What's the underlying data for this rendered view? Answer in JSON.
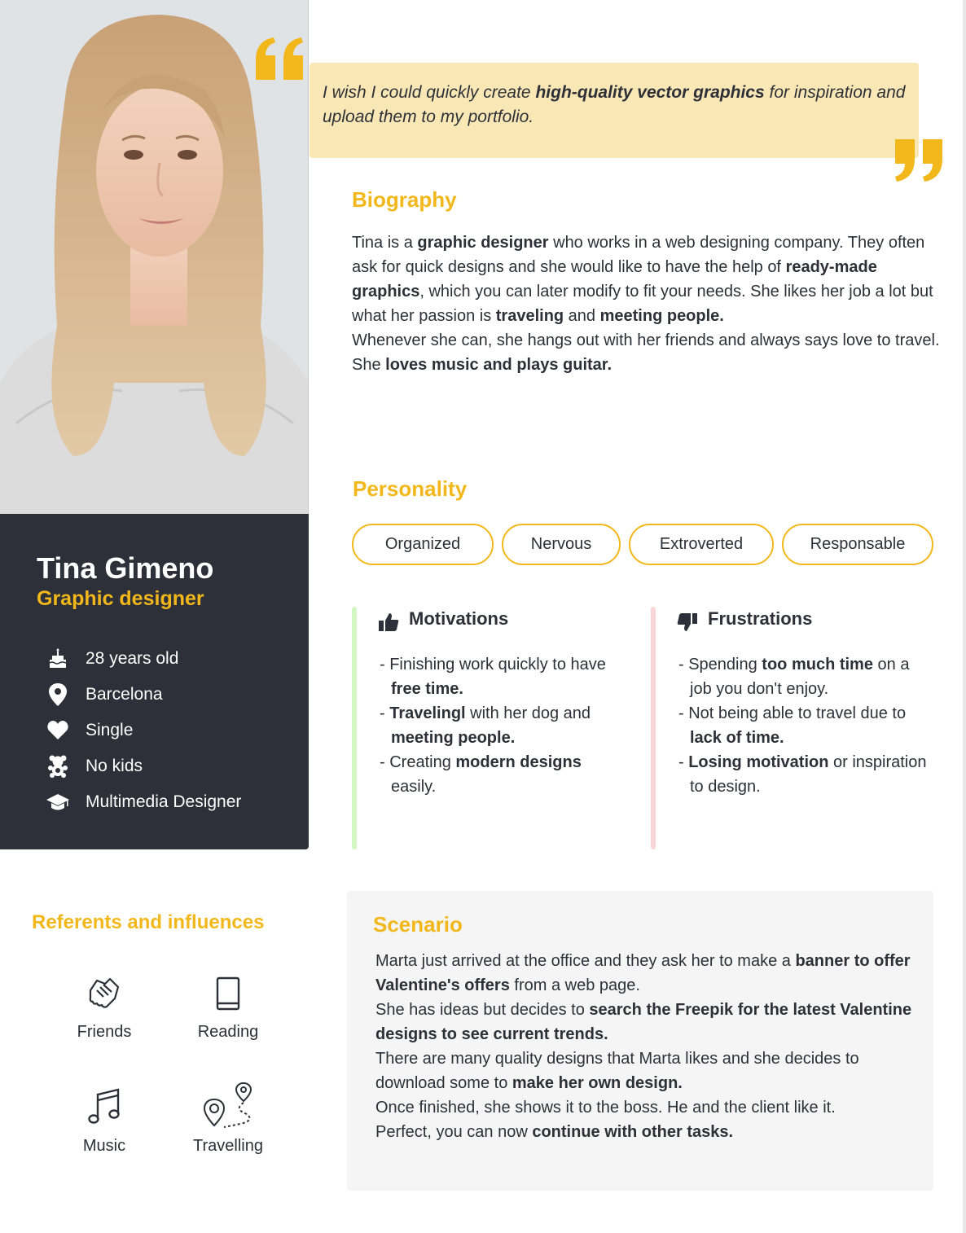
{
  "persona": {
    "name": "Tina Gimeno",
    "role": "Graphic designer",
    "facts": [
      {
        "icon": "birthday-cake-icon",
        "label": "28 years old"
      },
      {
        "icon": "location-pin-icon",
        "label": "Barcelona"
      },
      {
        "icon": "heart-icon",
        "label": "Single"
      },
      {
        "icon": "teddy-bear-icon",
        "label": "No kids"
      },
      {
        "icon": "graduation-cap-icon",
        "label": "Multimedia Designer"
      }
    ]
  },
  "quote": {
    "before": "I wish I could quickly create  ",
    "bold": "high-quality vector graphics",
    "after": " for inspiration and upload them to my portfolio."
  },
  "biography": {
    "title": "Biography",
    "runs": [
      {
        "t": "Tina is a "
      },
      {
        "t": "graphic designer",
        "b": true
      },
      {
        "t": " who works in a web designing company. They often ask for quick designs and she would like to have the help of "
      },
      {
        "t": "ready-made graphics",
        "b": true
      },
      {
        "t": ", which you can later modify to fit your needs. She likes her job a lot but what her passion is "
      },
      {
        "t": "traveling",
        "b": true
      },
      {
        "t": " and "
      },
      {
        "t": "meeting people.",
        "b": true
      },
      {
        "br": true
      },
      {
        "t": "Whenever she can, she hangs out with her friends and always says love to travel. She "
      },
      {
        "t": "loves music and plays guitar.",
        "b": true
      }
    ]
  },
  "personality": {
    "title": "Personality",
    "traits": [
      "Organized",
      "Nervous",
      "Extroverted",
      "Responsable"
    ]
  },
  "motivations": {
    "title": "Motivations",
    "items": [
      [
        {
          "t": "- Finishing work quickly to have "
        },
        {
          "t": "free time.",
          "b": true
        }
      ],
      [
        {
          "t": "- "
        },
        {
          "t": "Travelingl",
          "b": true
        },
        {
          "t": " with her dog and "
        },
        {
          "t": "meeting people.",
          "b": true
        }
      ],
      [
        {
          "t": "- Creating "
        },
        {
          "t": "modern designs",
          "b": true
        },
        {
          "t": " easily."
        }
      ]
    ]
  },
  "frustrations": {
    "title": "Frustrations",
    "items": [
      [
        {
          "t": "- Spending "
        },
        {
          "t": "too much time",
          "b": true
        },
        {
          "t": " on a job you don't enjoy."
        }
      ],
      [
        {
          "t": "- Not being able to travel due to "
        },
        {
          "t": "lack of time.",
          "b": true
        }
      ],
      [
        {
          "t": "- "
        },
        {
          "t": "Losing motivation",
          "b": true
        },
        {
          "t": " or inspiration to design."
        }
      ]
    ]
  },
  "referents": {
    "title": "Referents and influences",
    "items": [
      {
        "icon": "handshake-icon",
        "label": "Friends"
      },
      {
        "icon": "book-icon",
        "label": "Reading"
      },
      {
        "icon": "music-note-icon",
        "label": "Music"
      },
      {
        "icon": "travel-route-icon",
        "label": "Travelling"
      }
    ]
  },
  "scenario": {
    "title": "Scenario",
    "runs": [
      {
        "t": "Marta just arrived at the office and they ask her to make a "
      },
      {
        "t": "banner to offer Valentine's offers",
        "b": true
      },
      {
        "t": " from a web page."
      },
      {
        "br": true
      },
      {
        "t": "She has ideas but decides to "
      },
      {
        "t": "search the Freepik for the latest Valentine designs to see current trends.",
        "b": true
      },
      {
        "br": true
      },
      {
        "t": "There are many quality designs that Marta likes and she decides to download some to "
      },
      {
        "t": "make her own design.",
        "b": true
      },
      {
        "br": true
      },
      {
        "t": "Once finished, she shows it to the boss. He and the client like it."
      },
      {
        "br": true
      },
      {
        "t": "Perfect, you can now "
      },
      {
        "t": "continue with other tasks.",
        "b": true
      }
    ]
  },
  "colors": {
    "accent": "#f2b81b",
    "dark_panel": "#2d3038",
    "quote_bg": "#f9e8b6",
    "motivation_bar": "#d4f5c4",
    "frustration_bar": "#fbd6d6",
    "scenario_bg": "#f5f5f5"
  }
}
